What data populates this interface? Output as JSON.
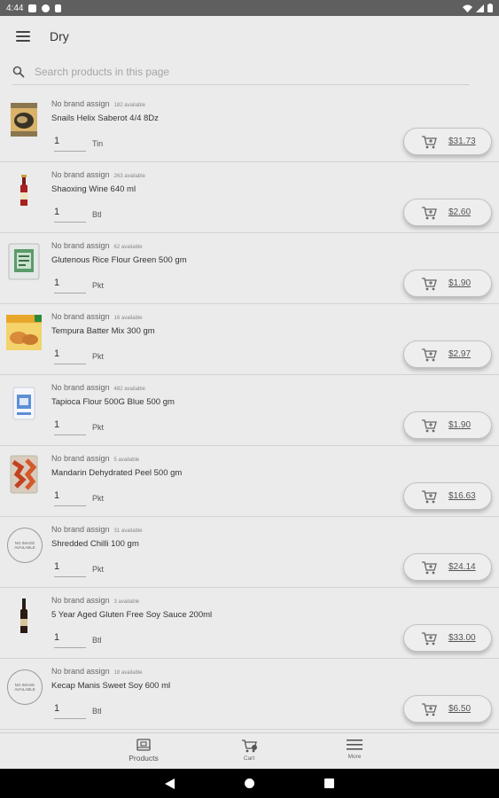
{
  "status_bar": {
    "time": "4:44"
  },
  "app_bar": {
    "title": "Dry"
  },
  "search": {
    "placeholder": "Search products in this page"
  },
  "products": [
    {
      "brand": "No brand assign",
      "available": "182 available",
      "name": "Snails Helix Saberot 4/4 8Dz",
      "qty": "1",
      "unit": "Tin",
      "price": "$31.73",
      "image": "snail-can"
    },
    {
      "brand": "No brand assign",
      "available": "263 available",
      "name": "Shaoxing Wine 640 ml",
      "qty": "1",
      "unit": "Btl",
      "price": "$2.60",
      "image": "wine-bottle"
    },
    {
      "brand": "No brand assign",
      "available": "62 available",
      "name": "Glutenous Rice Flour  Green 500 gm",
      "qty": "1",
      "unit": "Pkt",
      "price": "$1.90",
      "image": "flour-bag-green"
    },
    {
      "brand": "No brand assign",
      "available": "16 available",
      "name": "Tempura Batter Mix 300 gm",
      "qty": "1",
      "unit": "Pkt",
      "price": "$2.97",
      "image": "tempura-pack"
    },
    {
      "brand": "No brand assign",
      "available": "482 available",
      "name": "Tapioca Flour 500G Blue 500 gm",
      "qty": "1",
      "unit": "Pkt",
      "price": "$1.90",
      "image": "flour-bag-blue"
    },
    {
      "brand": "No brand assign",
      "available": "5 available",
      "name": "Mandarin Dehydrated Peel 500 gm",
      "qty": "1",
      "unit": "Pkt",
      "price": "$16.63",
      "image": "peel-pack"
    },
    {
      "brand": "No brand assign",
      "available": "31 available",
      "name": "Shredded Chilli 100 gm",
      "qty": "1",
      "unit": "Pkt",
      "price": "$24.14",
      "image": "no-image",
      "no_image_text": "NO IMAGE AVAILABLE"
    },
    {
      "brand": "No brand assign",
      "available": "3 available",
      "name": "5 Year Aged Gluten Free Soy Sauce 200ml",
      "qty": "1",
      "unit": "Btl",
      "price": "$33.00",
      "image": "sauce-bottle"
    },
    {
      "brand": "No brand assign",
      "available": "18 available",
      "name": "Kecap Manis Sweet Soy 600 ml",
      "qty": "1",
      "unit": "Btl",
      "price": "$6.50",
      "image": "no-image",
      "no_image_text": "NO IMAGE AVAILABLE"
    }
  ],
  "bottom_nav": [
    {
      "label": "Products",
      "icon": "products-icon"
    },
    {
      "label": "Cart",
      "icon": "cart-icon"
    },
    {
      "label": "More",
      "icon": "menu-icon"
    }
  ]
}
